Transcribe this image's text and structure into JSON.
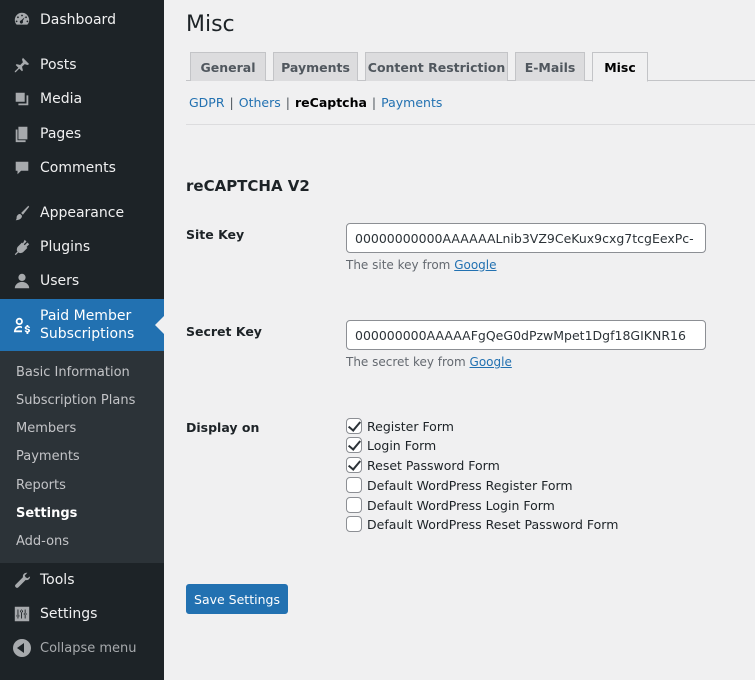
{
  "sidebar": {
    "items": [
      {
        "label": "Dashboard",
        "icon": "dashboard-icon"
      },
      {
        "label": "Posts",
        "icon": "pin-icon"
      },
      {
        "label": "Media",
        "icon": "media-icon"
      },
      {
        "label": "Pages",
        "icon": "pages-icon"
      },
      {
        "label": "Comments",
        "icon": "comment-icon"
      },
      {
        "label": "Appearance",
        "icon": "brush-icon"
      },
      {
        "label": "Plugins",
        "icon": "plugin-icon"
      },
      {
        "label": "Users",
        "icon": "user-icon"
      },
      {
        "label": "Paid Member\nSubscriptions",
        "label_line1": "Paid Member",
        "label_line2": "Subscriptions",
        "icon": "members-icon"
      },
      {
        "label": "Tools",
        "icon": "wrench-icon"
      },
      {
        "label": "Settings",
        "icon": "sliders-icon"
      }
    ],
    "submenu": [
      {
        "label": "Basic Information"
      },
      {
        "label": "Subscription Plans"
      },
      {
        "label": "Members"
      },
      {
        "label": "Payments"
      },
      {
        "label": "Reports"
      },
      {
        "label": "Settings"
      },
      {
        "label": "Add-ons"
      }
    ],
    "collapse_label": "Collapse menu"
  },
  "main": {
    "title": "Misc",
    "tabs": [
      {
        "label": "General"
      },
      {
        "label": "Payments"
      },
      {
        "label": "Content Restriction"
      },
      {
        "label": "E-Mails"
      },
      {
        "label": "Misc"
      }
    ],
    "subtabs": [
      {
        "label": "GDPR"
      },
      {
        "label": "Others"
      },
      {
        "label": "reCaptcha"
      },
      {
        "label": "Payments"
      }
    ],
    "subtab_separator": "|",
    "section_title": "reCAPTCHA V2",
    "site_key": {
      "label": "Site Key",
      "value": "00000000000AAAAAALnib3VZ9CeKux9cxg7tcgEexPc-",
      "desc_prefix": "The site key from",
      "desc_link": "Google"
    },
    "secret_key": {
      "label": "Secret Key",
      "value": "000000000AAAAAFgQeG0dPzwMpet1Dgf18GIKNR16",
      "desc_prefix": "The secret key from",
      "desc_link": "Google"
    },
    "display_on": {
      "label": "Display on",
      "options": [
        {
          "label": "Register Form",
          "checked": true
        },
        {
          "label": "Login Form",
          "checked": true
        },
        {
          "label": "Reset Password Form",
          "checked": true
        },
        {
          "label": "Default WordPress Register Form",
          "checked": false
        },
        {
          "label": "Default WordPress Login Form",
          "checked": false
        },
        {
          "label": "Default WordPress Reset Password Form",
          "checked": false
        }
      ]
    },
    "save_label": "Save Settings"
  },
  "colors": {
    "sidebar_bg": "#1d2327",
    "submenu_bg": "#2c3338",
    "accent": "#2271b1",
    "page_bg": "#f0f0f1"
  }
}
